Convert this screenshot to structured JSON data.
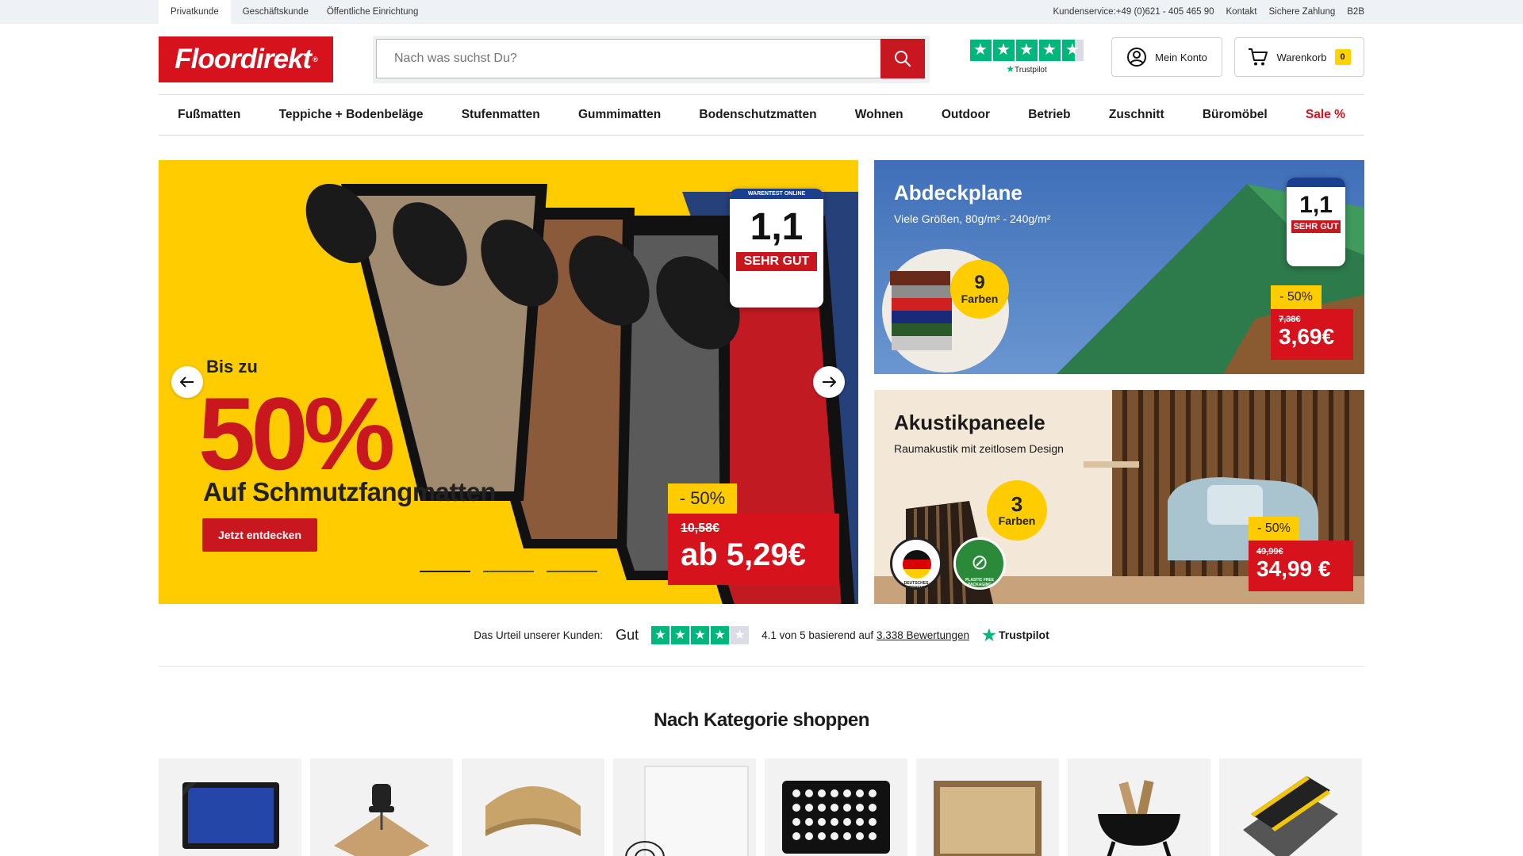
{
  "topbar": {
    "segments": [
      "Privatkunde",
      "Geschäftskunde",
      "Öffentliche Einrichtung"
    ],
    "service": "Kundenservice:+49 (0)621 - 405 465 90",
    "kontakt": "Kontakt",
    "payment": "Sichere Zahlung",
    "b2b": "B2B"
  },
  "header": {
    "logo": "Floordirekt",
    "logo_reg": "®",
    "search_placeholder": "Nach was suchst Du?",
    "trustpilot_label": "Trustpilot",
    "account_label": "Mein Konto",
    "cart_label": "Warenkorb",
    "cart_count": "0"
  },
  "nav": {
    "items": [
      "Fußmatten",
      "Teppiche + Bodenbeläge",
      "Stufenmatten",
      "Gummimatten",
      "Bodenschutzmatten",
      "Wohnen",
      "Outdoor",
      "Betrieb",
      "Zuschnitt",
      "Büromöbel",
      "Sale %"
    ]
  },
  "hero": {
    "pre": "Bis zu",
    "percent": "50%",
    "subtitle": "Auf Schmutzfangmatten",
    "cta": "Jetzt entdecken",
    "discount": "- 50%",
    "old_price": "10,58€",
    "new_price": "ab 5,29€",
    "seal_top": "WARENTEST ONLINE",
    "seal_grade": "1,1",
    "seal_label": "SEHR GUT",
    "slides": 3,
    "active_slide": 1
  },
  "promo1": {
    "title": "Abdeckplane",
    "subtitle": "Viele Größen, 80g/m² - 240g/m²",
    "colors_num": "9",
    "colors_word": "Farben",
    "discount": "- 50%",
    "old_price": "7,38€",
    "new_price": "3,69€",
    "seal_grade": "1,1",
    "seal_label": "SEHR GUT"
  },
  "promo2": {
    "title": "Akustikpaneele",
    "subtitle": "Raumakustik mit zeitlosem Design",
    "colors_num": "3",
    "colors_word": "Farben",
    "discount": "- 50%",
    "old_price": "49,99€",
    "new_price": "34,99 €",
    "badge_de": "DEUTSCHES UNTERNEHMEN",
    "badge_plastic": "PLASTIC FREE PACKAGING"
  },
  "trust": {
    "intro": "Das Urteil unserer Kunden:",
    "word": "Gut",
    "stars": 4,
    "meta_prefix": "4.1 von 5 basierend auf",
    "reviews_link": "3.338 Bewertungen",
    "brand": "Trustpilot"
  },
  "categories": {
    "title": "Nach Kategorie shoppen",
    "items": [
      "doormat-icon",
      "chair-mat-icon",
      "stair-mat-icon",
      "clear-mat-roll-icon",
      "rubber-ring-mat-icon",
      "sisal-rug-icon",
      "fire-pit-icon",
      "anti-fatigue-mat-icon"
    ]
  },
  "colors": {
    "brand_red": "#d6121c",
    "accent_yellow": "#ffcc00",
    "trustpilot_green": "#00b67a"
  }
}
